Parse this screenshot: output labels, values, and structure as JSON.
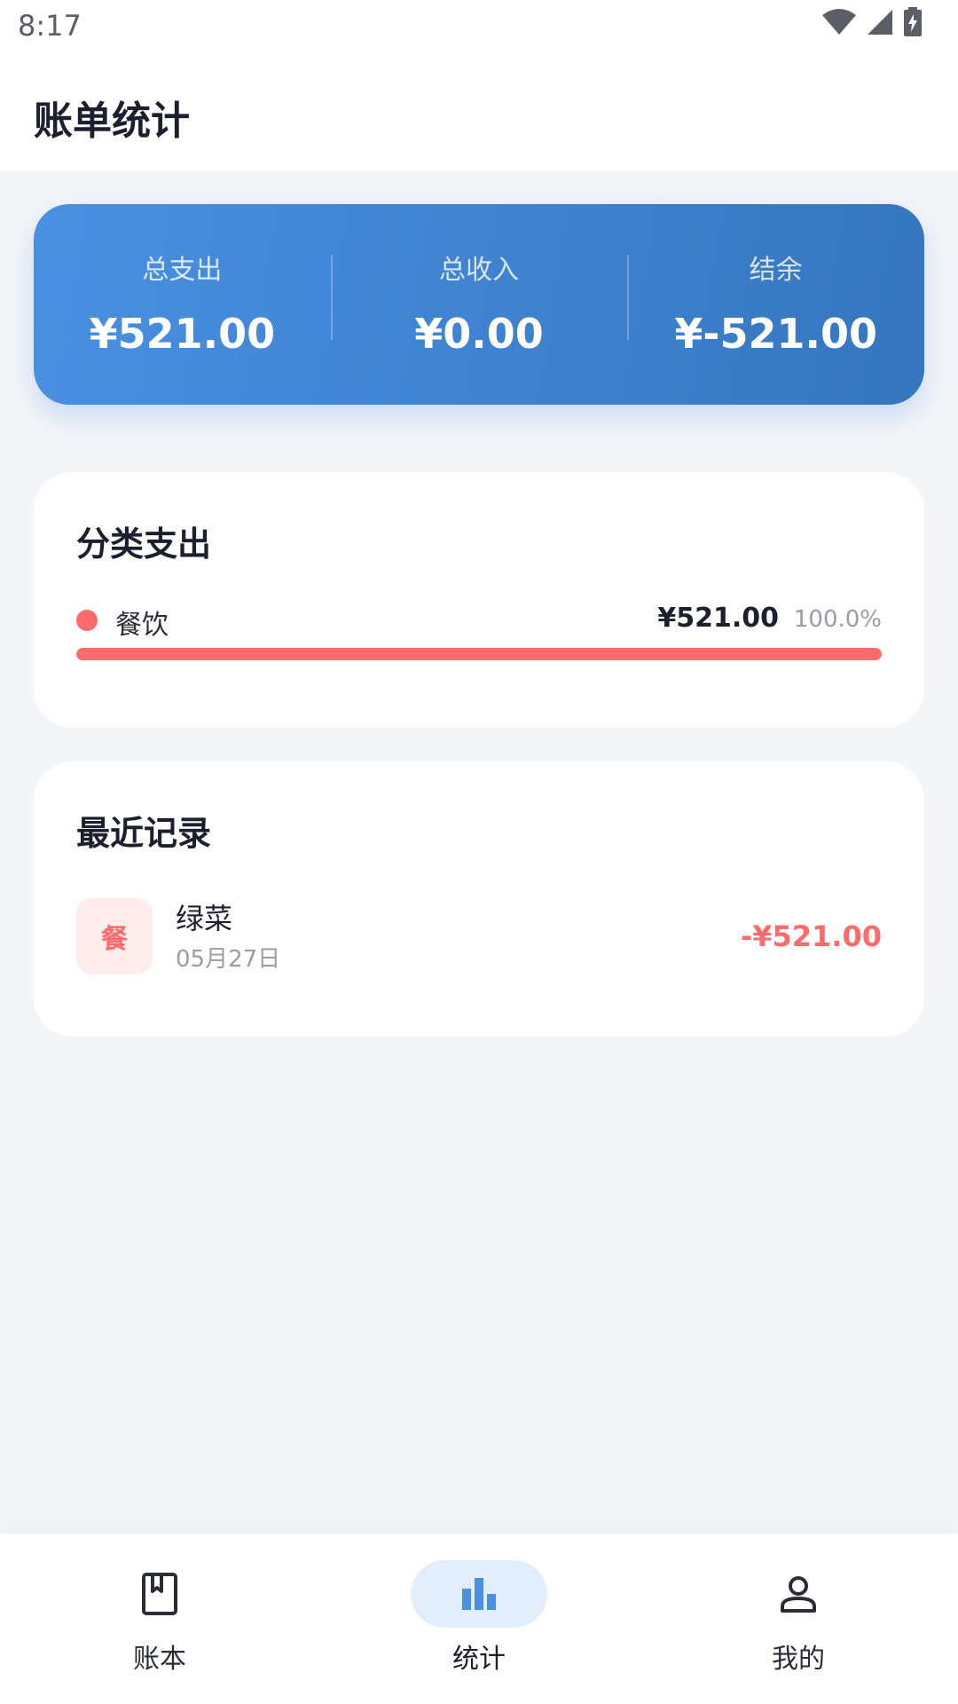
{
  "status_bar": {
    "time": "8:17",
    "icons": [
      "wifi-icon",
      "signal-icon",
      "battery-charging-icon"
    ]
  },
  "header": {
    "title": "账单统计"
  },
  "summary": {
    "items": [
      {
        "label": "总支出",
        "value": "¥521.00"
      },
      {
        "label": "总收入",
        "value": "¥0.00"
      },
      {
        "label": "结余",
        "value": "¥-521.00"
      }
    ]
  },
  "category": {
    "title": "分类支出",
    "items": [
      {
        "name": "餐饮",
        "amount": "¥521.00",
        "percent": "100.0%",
        "fraction": 1.0,
        "color": "#FF6B6B"
      }
    ]
  },
  "recent": {
    "title": "最近记录",
    "items": [
      {
        "icon_text": "餐",
        "name": "绿菜",
        "date": "05月27日",
        "amount": "-¥521.00"
      }
    ]
  },
  "bottom_nav": {
    "items": [
      {
        "label": "账本",
        "icon": "book-icon",
        "active": false
      },
      {
        "label": "统计",
        "icon": "bar-chart-icon",
        "active": true
      },
      {
        "label": "我的",
        "icon": "person-icon",
        "active": false
      }
    ]
  },
  "colors": {
    "accent": "#4A90E2",
    "expense": "#FF6B6B",
    "background": "#F3F5F8"
  }
}
